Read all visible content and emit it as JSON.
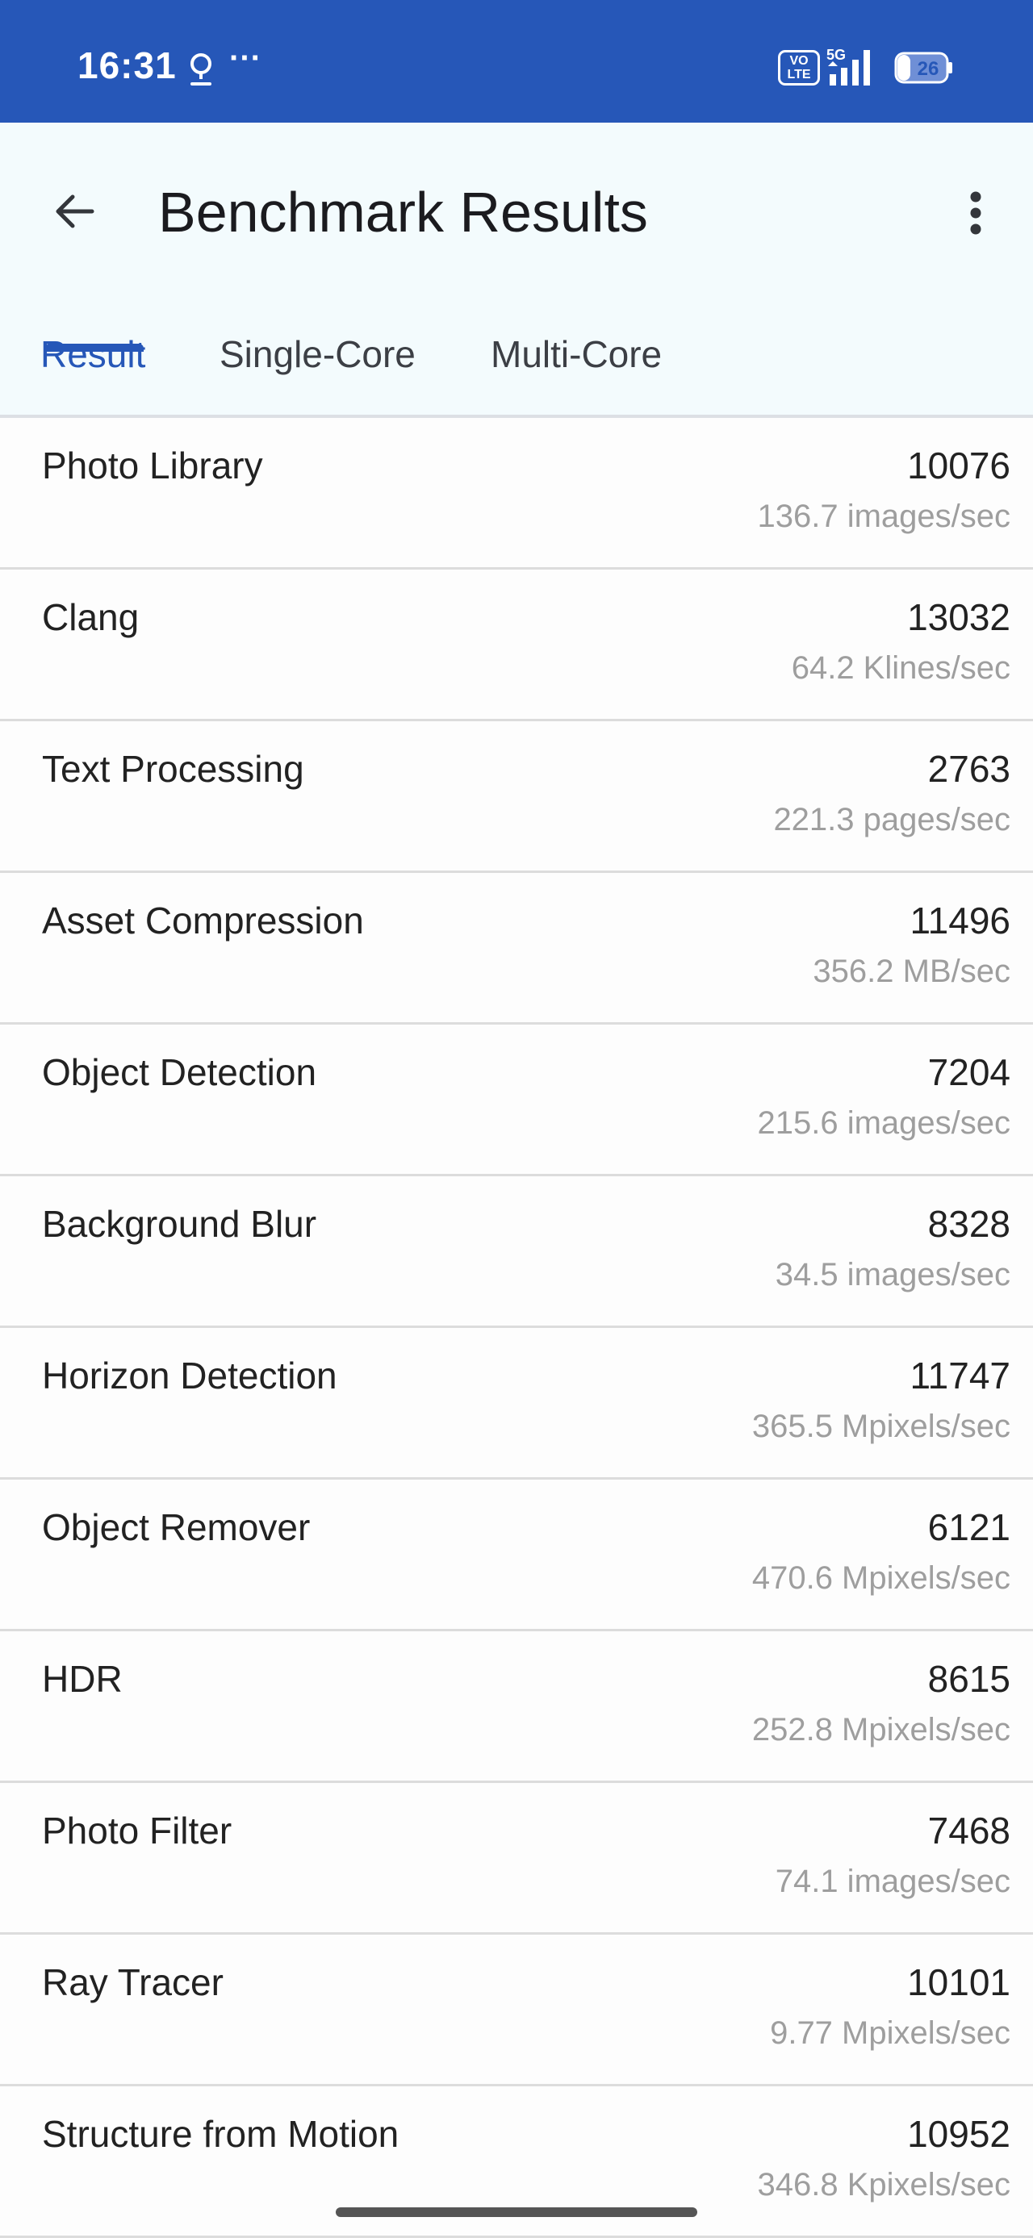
{
  "status_bar": {
    "time": "16:31",
    "dots": "···",
    "volte_line1": "VO",
    "volte_line2": "LTE",
    "network": "5G",
    "battery": "26",
    "background_color": "#2657b8"
  },
  "app_bar": {
    "title": "Benchmark Results",
    "back_icon": "arrow-left-icon",
    "menu_icon": "more-vert-icon"
  },
  "tabs": [
    {
      "label": "Result",
      "active": true
    },
    {
      "label": "Single-Core",
      "active": false
    },
    {
      "label": "Multi-Core",
      "active": false
    }
  ],
  "accent_color": "#2657b8",
  "results": [
    {
      "name": "Photo Library",
      "score": "10076",
      "rate": "136.7 images/sec"
    },
    {
      "name": "Clang",
      "score": "13032",
      "rate": "64.2 Klines/sec"
    },
    {
      "name": "Text Processing",
      "score": "2763",
      "rate": "221.3 pages/sec"
    },
    {
      "name": "Asset Compression",
      "score": "11496",
      "rate": "356.2 MB/sec"
    },
    {
      "name": "Object Detection",
      "score": "7204",
      "rate": "215.6 images/sec"
    },
    {
      "name": "Background Blur",
      "score": "8328",
      "rate": "34.5 images/sec"
    },
    {
      "name": "Horizon Detection",
      "score": "11747",
      "rate": "365.5 Mpixels/sec"
    },
    {
      "name": "Object Remover",
      "score": "6121",
      "rate": "470.6 Mpixels/sec"
    },
    {
      "name": "HDR",
      "score": "8615",
      "rate": "252.8 Mpixels/sec"
    },
    {
      "name": "Photo Filter",
      "score": "7468",
      "rate": "74.1 images/sec"
    },
    {
      "name": "Ray Tracer",
      "score": "10101",
      "rate": "9.77 Mpixels/sec"
    },
    {
      "name": "Structure from Motion",
      "score": "10952",
      "rate": "346.8 Kpixels/sec"
    }
  ]
}
